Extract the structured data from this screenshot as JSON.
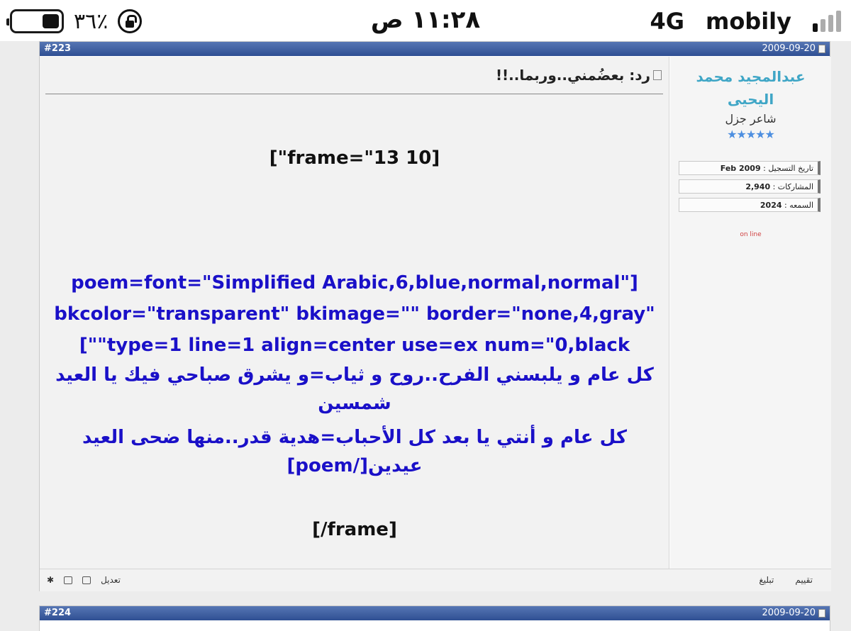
{
  "status_bar": {
    "battery_percent": "٣٦٪",
    "battery_level": 0.36,
    "time": "١١:٢٨ ص",
    "network": "4G",
    "carrier": "mobily",
    "battery_icon": "battery-icon",
    "lock_icon": "orientation-lock-icon",
    "signal_icon": "signal-bars-icon"
  },
  "posts": [
    {
      "number": "#223",
      "date": "2009-09-20",
      "title": "رد: بعضُمني..وربما..!!",
      "content": {
        "frame_open": "[\"frame=\"13 10]",
        "poem_params": [
          "poem=font=\"Simplified Arabic,6,blue,normal,normal\"]",
          "bkcolor=\"transparent\" bkimage=\"\" border=\"none,4,gray\"",
          "[\"\"type=1 line=1 align=center use=ex num=\"0,black"
        ],
        "verses": [
          "كل عام و يلبسني الفرح..روح و ثياب=و يشرق صباحي فيك يا العيد",
          "شمسين",
          "كل عام و أنتي يا بعد كل الأحباب=هدية قدر..منها ضحى العيد",
          "عيدين[/poem]"
        ],
        "frame_close": "[/frame]"
      },
      "user": {
        "name_line1": "عبدالمجيد محمد",
        "name_line2": "اليحيى",
        "rank": "شاعر جزل",
        "stars": "★★★★★",
        "stats": [
          {
            "label": "تاريخ التسجيل : ",
            "value": "Feb 2009"
          },
          {
            "label": "المشاركات : ",
            "value": "2,940"
          },
          {
            "label": "السمعه : ",
            "value": "2024"
          }
        ],
        "online": "on line"
      },
      "footer": {
        "edit": "تعديل",
        "rate": "تقييم",
        "report": "تبليغ"
      }
    },
    {
      "number": "#224",
      "date": "2009-09-20"
    }
  ],
  "colors": {
    "header_blue": "#2f4f93",
    "poem_blue": "#1a10c8",
    "username": "#3fa6c6"
  }
}
